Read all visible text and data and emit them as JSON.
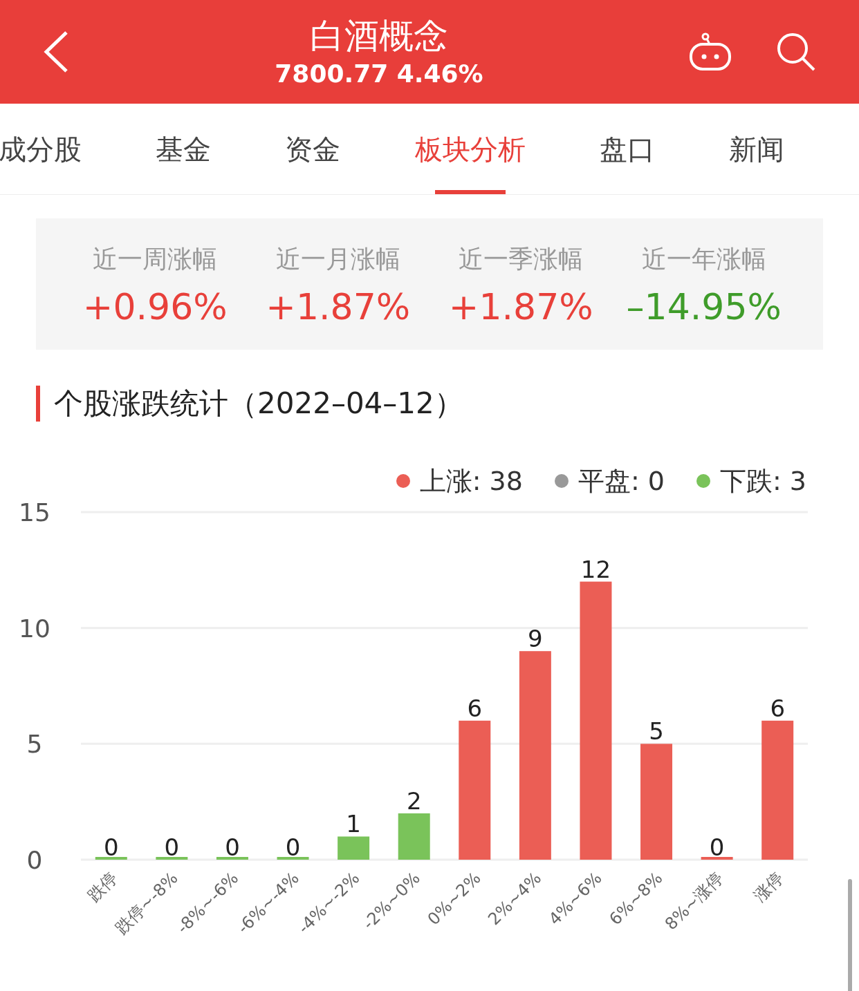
{
  "header": {
    "title": "白酒概念",
    "quote": "7800.77 4.46%"
  },
  "tabs": [
    {
      "label": "成分股",
      "selected": false
    },
    {
      "label": "基金",
      "selected": false
    },
    {
      "label": "资金",
      "selected": false
    },
    {
      "label": "板块分析",
      "selected": true
    },
    {
      "label": "盘口",
      "selected": false
    },
    {
      "label": "新闻",
      "selected": false
    }
  ],
  "stats": [
    {
      "label": "近一周涨幅",
      "value": "+0.96%",
      "kind": "up"
    },
    {
      "label": "近一月涨幅",
      "value": "+1.87%",
      "kind": "up"
    },
    {
      "label": "近一季涨幅",
      "value": "+1.87%",
      "kind": "up"
    },
    {
      "label": "近一年涨幅",
      "value": "–14.95%",
      "kind": "down"
    }
  ],
  "section_title": "个股涨跌统计（2022–04–12）",
  "legend": [
    {
      "label": "上涨: 38",
      "color": "#eb5e55"
    },
    {
      "label": "平盘: 0",
      "color": "#999999"
    },
    {
      "label": "下跌: 3",
      "color": "#7ac35a"
    }
  ],
  "chart_data": {
    "type": "bar",
    "categories": [
      "跌停",
      "跌停~-8%",
      "-8%~-6%",
      "-6%~-4%",
      "-4%~-2%",
      "-2%~0%",
      "0%~2%",
      "2%~4%",
      "4%~6%",
      "6%~8%",
      "8%~涨停",
      "涨停"
    ],
    "series": [
      {
        "color": "#7ac35a",
        "values": [
          0,
          0,
          0,
          0,
          1,
          2,
          null,
          null,
          null,
          null,
          null,
          null
        ]
      },
      {
        "color": "#eb5e55",
        "values": [
          null,
          null,
          null,
          null,
          null,
          null,
          6,
          9,
          12,
          5,
          0,
          6
        ]
      }
    ],
    "ylim": [
      0,
      15
    ],
    "yticks": [
      0,
      5,
      10,
      15
    ],
    "stacked": true,
    "data_labels": true
  }
}
